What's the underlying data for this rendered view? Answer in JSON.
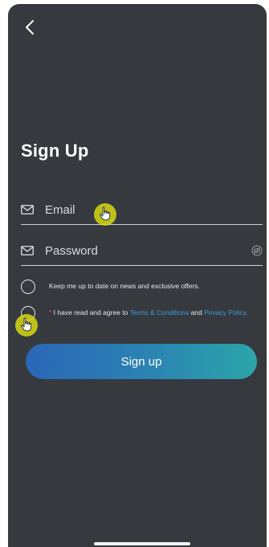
{
  "header": {
    "back_icon": "chevron-left-icon"
  },
  "title": "Sign Up",
  "form": {
    "email": {
      "placeholder": "Email",
      "value": "",
      "icon": "mail-icon"
    },
    "password": {
      "placeholder": "Password",
      "value": "",
      "icon": "mail-icon",
      "toggle_icon": "eye-off-icon"
    }
  },
  "checkboxes": {
    "newsletter": {
      "label": "Keep me up to date on news and exclusive offers."
    },
    "terms": {
      "required_mark": "*",
      "prefix": " I have read and agree to ",
      "terms_link": "Terms & Conditions",
      "and": " and ",
      "privacy_link": "Privacy Policy",
      "suffix": "."
    }
  },
  "signup_button": {
    "label": "Sign up"
  },
  "colors": {
    "background": "#36393d",
    "link": "#3a9fe0",
    "button_gradient_start": "#2b66b6",
    "button_gradient_end": "#2ba6a9",
    "required": "#ff4d4d",
    "cursor_highlight": "#d6d814"
  }
}
